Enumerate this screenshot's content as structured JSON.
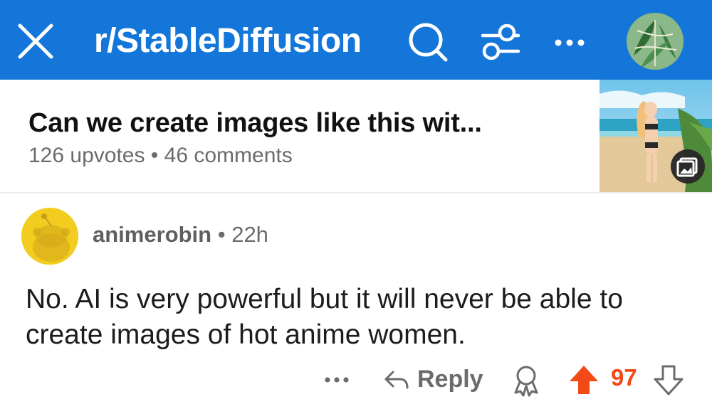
{
  "header": {
    "title": "r/StableDiffusion",
    "background": "#1376d8",
    "icons": [
      "close-icon",
      "search-icon",
      "filter-icon",
      "more-icon"
    ]
  },
  "post": {
    "title": "Can we create images like this wit...",
    "meta": "126 upvotes • 46 comments",
    "thumbnail_badge_icon": "image-gallery-icon"
  },
  "comment": {
    "author": "animerobin",
    "separator": "•",
    "age": "22h",
    "body": "No. AI is very powerful but it will never be able to create images of hot anime women.",
    "actions": {
      "more_icon": "more-icon",
      "reply_label": "Reply",
      "award_icon": "award-icon",
      "score": "97",
      "upvote_color": "#f24a16"
    }
  }
}
